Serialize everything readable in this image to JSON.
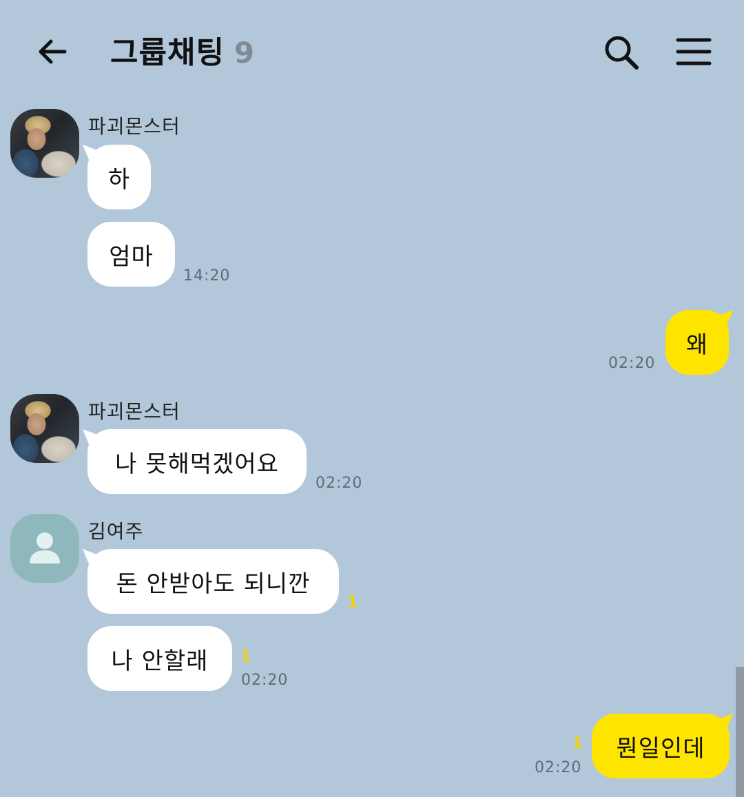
{
  "header": {
    "title": "그룹채팅",
    "member_count": "9",
    "back_icon": "back-arrow-icon",
    "search_icon": "search-icon",
    "menu_icon": "hamburger-menu-icon"
  },
  "colors": {
    "background": "#b2c7da",
    "incoming_bubble": "#ffffff",
    "outgoing_bubble": "#fee500",
    "unread_count": "#f2d300"
  },
  "messages": [
    {
      "sender": "파괴몬스터",
      "text": "하",
      "direction": "in"
    },
    {
      "text": "엄마",
      "time": "14:20",
      "direction": "in"
    },
    {
      "text": "왜",
      "time": "02:20",
      "direction": "out"
    },
    {
      "sender": "파괴몬스터",
      "text": "나 못해먹겠어요",
      "time": "02:20",
      "direction": "in"
    },
    {
      "sender": "김여주",
      "text": "돈 안받아도 되니깐",
      "unread": "1",
      "direction": "in"
    },
    {
      "text": "나 안할래",
      "unread": "1",
      "time": "02:20",
      "direction": "in"
    },
    {
      "text": "뭔일인데",
      "unread": "1",
      "time": "02:20",
      "direction": "out"
    }
  ]
}
